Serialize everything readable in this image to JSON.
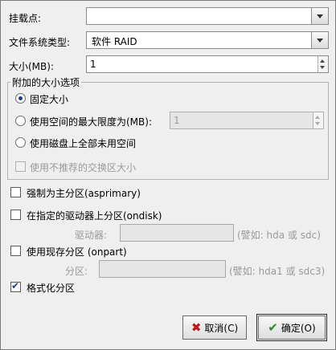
{
  "mount_point": {
    "label": "挂载点:",
    "value": ""
  },
  "fs_type": {
    "label": "文件系统类型:",
    "value": "软件  RAID"
  },
  "size": {
    "label": "大小(MB):",
    "value": "1"
  },
  "size_options": {
    "title": "附加的大小选项",
    "fixed": {
      "label": "固定大小",
      "checked": true
    },
    "up_to": {
      "label": "使用空间的最大限度为(MB):",
      "value": "1"
    },
    "fill": {
      "label": "使用磁盘上全部未用空间"
    },
    "swap": {
      "label": "使用不推荐的交换区大小"
    }
  },
  "force_primary": {
    "label": "强制为主分区(asprimary)"
  },
  "ondisk": {
    "label": "在指定的驱动器上分区(ondisk)",
    "field_label": "驱动器:",
    "hint": "(譬如: hda 或 sdc)"
  },
  "onpart": {
    "label": "使用现存分区 (onpart)",
    "field_label": "分区:",
    "hint": "(譬如: hda1 或 sdc3)"
  },
  "format": {
    "label": "格式化分区",
    "checked": true
  },
  "buttons": {
    "cancel": "取消(C)",
    "ok": "确定(O)"
  }
}
